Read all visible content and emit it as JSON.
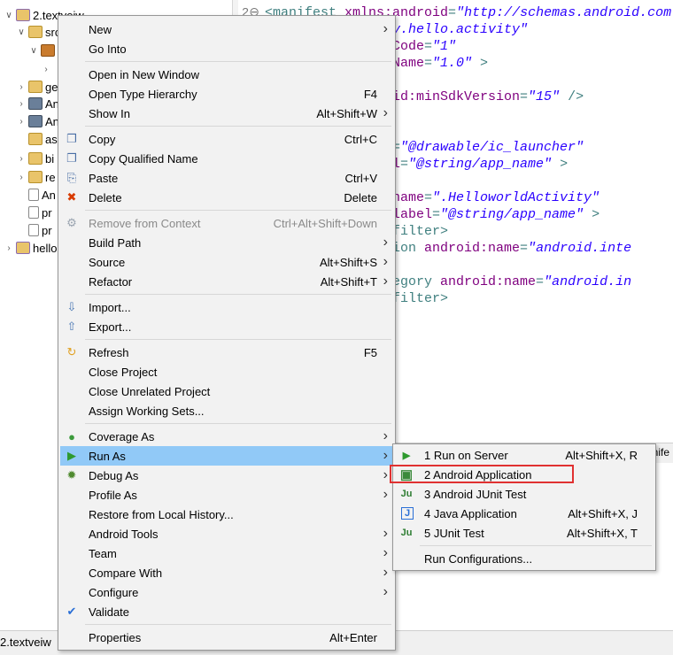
{
  "explorer": {
    "items": [
      {
        "label": "2.textveiw",
        "icon": "project-icon",
        "twisty": "v"
      },
      {
        "label": "src",
        "icon": "folder-icon",
        "twisty": "v"
      },
      {
        "label": "",
        "icon": "package-icon",
        "twisty": "v"
      },
      {
        "label": "",
        "icon": "",
        "twisty": ">"
      },
      {
        "label": "ge",
        "icon": "folder-icon",
        "twisty": ">"
      },
      {
        "label": "An",
        "icon": "library-icon",
        "twisty": ">"
      },
      {
        "label": "An",
        "icon": "library-icon",
        "twisty": ">"
      },
      {
        "label": "as",
        "icon": "folder-icon",
        "twisty": ""
      },
      {
        "label": "bi",
        "icon": "folder-icon",
        "twisty": ">"
      },
      {
        "label": "re",
        "icon": "folder-icon",
        "twisty": ">"
      },
      {
        "label": "An",
        "icon": "file-icon",
        "twisty": ""
      },
      {
        "label": "pr",
        "icon": "file-icon",
        "twisty": ""
      },
      {
        "label": "pr",
        "icon": "file-icon",
        "twisty": ""
      },
      {
        "label": "hello",
        "icon": "project-icon",
        "twisty": ">"
      }
    ],
    "bottom_label": "2.textveiw"
  },
  "editor": {
    "lines": [
      {
        "num": "2⊖",
        "parts": [
          [
            "tag",
            "<manifest "
          ],
          [
            "attr",
            "xmlns:android"
          ],
          [
            "tag",
            "="
          ],
          [
            "val",
            "\"http://schemas.android.com"
          ]
        ]
      },
      {
        "num": "",
        "parts": [
          [
            "val",
            "n.szy.hello.activity\""
          ]
        ]
      },
      {
        "num": "",
        "parts": [
          [
            "attr",
            "sionCode"
          ],
          [
            "tag",
            "="
          ],
          [
            "val",
            "\"1\""
          ]
        ]
      },
      {
        "num": "",
        "parts": [
          [
            "attr",
            "sionName"
          ],
          [
            "tag",
            "="
          ],
          [
            "val",
            "\"1.0\""
          ],
          [
            "tag",
            " >"
          ]
        ]
      },
      {
        "num": "",
        "parts": []
      },
      {
        "num": "",
        "parts": [
          [
            "attr",
            "ndroid:minSdkVersion"
          ],
          [
            "tag",
            "="
          ],
          [
            "val",
            "\"15\""
          ],
          [
            "tag",
            " />"
          ]
        ]
      },
      {
        "num": "",
        "parts": []
      },
      {
        "num": "",
        "parts": [
          [
            "tag",
            "n"
          ]
        ]
      },
      {
        "num": "",
        "parts": [
          [
            "attr",
            "icon"
          ],
          [
            "tag",
            "="
          ],
          [
            "val",
            "\"@drawable/ic_launcher\""
          ]
        ]
      },
      {
        "num": "",
        "parts": [
          [
            "attr",
            "label"
          ],
          [
            "tag",
            "="
          ],
          [
            "val",
            "\"@string/app_name\""
          ],
          [
            "tag",
            " >"
          ]
        ]
      },
      {
        "num": "",
        "parts": [
          [
            "tag",
            "ty"
          ]
        ]
      },
      {
        "num": "",
        "parts": [
          [
            "attr",
            "oid:name"
          ],
          [
            "tag",
            "="
          ],
          [
            "val",
            "\".HelloworldActivity\""
          ]
        ]
      },
      {
        "num": "",
        "parts": [
          [
            "attr",
            "oid:label"
          ],
          [
            "tag",
            "="
          ],
          [
            "val",
            "\"@string/app_name\""
          ],
          [
            "tag",
            " >"
          ]
        ]
      },
      {
        "num": "",
        "parts": [
          [
            "tag",
            "ent-filter>"
          ]
        ]
      },
      {
        "num": "",
        "parts": [
          [
            "tag",
            "<action "
          ],
          [
            "attr",
            "android:name"
          ],
          [
            "tag",
            "="
          ],
          [
            "val",
            "\"android.inte"
          ]
        ]
      },
      {
        "num": "",
        "parts": []
      },
      {
        "num": "",
        "parts": [
          [
            "tag",
            "<category "
          ],
          [
            "attr",
            "android:name"
          ],
          [
            "tag",
            "="
          ],
          [
            "val",
            "\"android.in"
          ]
        ]
      },
      {
        "num": "",
        "parts": [
          [
            "tag",
            "ent-filter>"
          ]
        ]
      },
      {
        "num": "",
        "parts": [
          [
            "tag",
            "ity>"
          ]
        ]
      },
      {
        "num": "",
        "parts": [
          [
            "tag",
            "on>"
          ]
        ]
      }
    ],
    "tab_label_partial": "anife"
  },
  "menu": {
    "items": [
      {
        "label": "New",
        "shortcut": "",
        "submenu": true,
        "icon": "",
        "sep_before": false
      },
      {
        "label": "Go Into",
        "shortcut": "",
        "submenu": false,
        "icon": "",
        "sep_before": false
      },
      {
        "label": "Open in New Window",
        "shortcut": "",
        "submenu": false,
        "icon": "",
        "sep_before": true
      },
      {
        "label": "Open Type Hierarchy",
        "shortcut": "F4",
        "submenu": false,
        "icon": "",
        "sep_before": false
      },
      {
        "label": "Show In",
        "shortcut": "Alt+Shift+W",
        "submenu": true,
        "icon": "",
        "sep_before": false
      },
      {
        "label": "Copy",
        "shortcut": "Ctrl+C",
        "submenu": false,
        "icon": "copy-icon",
        "sep_before": true
      },
      {
        "label": "Copy Qualified Name",
        "shortcut": "",
        "submenu": false,
        "icon": "copy-icon",
        "sep_before": false
      },
      {
        "label": "Paste",
        "shortcut": "Ctrl+V",
        "submenu": false,
        "icon": "paste-icon",
        "sep_before": false
      },
      {
        "label": "Delete",
        "shortcut": "Delete",
        "submenu": false,
        "icon": "delete-icon",
        "sep_before": false
      },
      {
        "label": "Remove from Context",
        "shortcut": "Ctrl+Alt+Shift+Down",
        "submenu": false,
        "icon": "remove-context-icon",
        "sep_before": true,
        "disabled": true
      },
      {
        "label": "Build Path",
        "shortcut": "",
        "submenu": true,
        "icon": "",
        "sep_before": false
      },
      {
        "label": "Source",
        "shortcut": "Alt+Shift+S",
        "submenu": true,
        "icon": "",
        "sep_before": false
      },
      {
        "label": "Refactor",
        "shortcut": "Alt+Shift+T",
        "submenu": true,
        "icon": "",
        "sep_before": false
      },
      {
        "label": "Import...",
        "shortcut": "",
        "submenu": false,
        "icon": "import-icon",
        "sep_before": true
      },
      {
        "label": "Export...",
        "shortcut": "",
        "submenu": false,
        "icon": "export-icon",
        "sep_before": false
      },
      {
        "label": "Refresh",
        "shortcut": "F5",
        "submenu": false,
        "icon": "refresh-icon",
        "sep_before": true
      },
      {
        "label": "Close Project",
        "shortcut": "",
        "submenu": false,
        "icon": "",
        "sep_before": false
      },
      {
        "label": "Close Unrelated Project",
        "shortcut": "",
        "submenu": false,
        "icon": "",
        "sep_before": false
      },
      {
        "label": "Assign Working Sets...",
        "shortcut": "",
        "submenu": false,
        "icon": "",
        "sep_before": false
      },
      {
        "label": "Coverage As",
        "shortcut": "",
        "submenu": true,
        "icon": "coverage-icon",
        "sep_before": true
      },
      {
        "label": "Run As",
        "shortcut": "",
        "submenu": true,
        "icon": "run-icon",
        "sep_before": false,
        "highlighted": true
      },
      {
        "label": "Debug As",
        "shortcut": "",
        "submenu": true,
        "icon": "debug-icon",
        "sep_before": false
      },
      {
        "label": "Profile As",
        "shortcut": "",
        "submenu": true,
        "icon": "",
        "sep_before": false
      },
      {
        "label": "Restore from Local History...",
        "shortcut": "",
        "submenu": false,
        "icon": "",
        "sep_before": false
      },
      {
        "label": "Android Tools",
        "shortcut": "",
        "submenu": true,
        "icon": "",
        "sep_before": false
      },
      {
        "label": "Team",
        "shortcut": "",
        "submenu": true,
        "icon": "",
        "sep_before": false
      },
      {
        "label": "Compare With",
        "shortcut": "",
        "submenu": true,
        "icon": "",
        "sep_before": false
      },
      {
        "label": "Configure",
        "shortcut": "",
        "submenu": true,
        "icon": "",
        "sep_before": false
      },
      {
        "label": "Validate",
        "shortcut": "",
        "submenu": false,
        "icon": "check-icon",
        "sep_before": false
      },
      {
        "label": "Properties",
        "shortcut": "Alt+Enter",
        "submenu": false,
        "icon": "",
        "sep_before": true
      }
    ]
  },
  "submenu": {
    "items": [
      {
        "label": "1 Run on Server",
        "shortcut": "Alt+Shift+X, R",
        "icon": "server-icon"
      },
      {
        "label": "2 Android Application",
        "shortcut": "",
        "icon": "android-app-icon",
        "boxed": true
      },
      {
        "label": "3 Android JUnit Test",
        "shortcut": "",
        "icon": "junit-icon"
      },
      {
        "label": "4 Java Application",
        "shortcut": "Alt+Shift+X, J",
        "icon": "java-app-icon"
      },
      {
        "label": "5 JUnit Test",
        "shortcut": "Alt+Shift+X, T",
        "icon": "junit-icon"
      },
      {
        "label": "Run Configurations...",
        "shortcut": "",
        "icon": "",
        "sep_before": true
      }
    ]
  },
  "colors": {
    "highlight": "#91c9f7",
    "menu_bg": "#f2f2f2",
    "red_box": "#e03131"
  }
}
